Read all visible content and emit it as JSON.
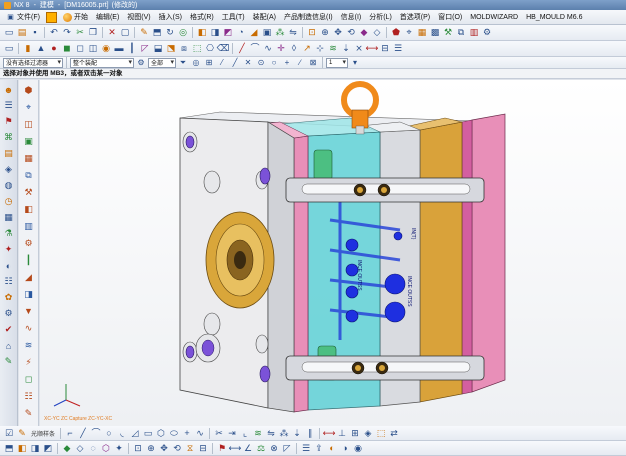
{
  "titlebar": {
    "app_name": "NX 8",
    "application": "建模",
    "file_name": "[DM16005.prt]",
    "status": "(修改的)"
  },
  "menubar": {
    "items": [
      {
        "label": "文件(F)"
      },
      {
        "label": "开始"
      },
      {
        "label": "编辑(E)"
      },
      {
        "label": "视图(V)"
      },
      {
        "label": "插入(S)"
      },
      {
        "label": "格式(R)"
      },
      {
        "label": "工具(T)"
      },
      {
        "label": "装配(A)"
      },
      {
        "label": "产品制造信息(I)"
      },
      {
        "label": "信息(I)"
      },
      {
        "label": "分析(L)"
      },
      {
        "label": "首选项(P)"
      },
      {
        "label": "窗口(O)"
      },
      {
        "label": "MOLDWIZARD"
      },
      {
        "label": "HB_MOULD M6.6"
      }
    ]
  },
  "selection_bar": {
    "filter_value": "没有选择过滤器",
    "assembly_value": "整个装配",
    "scope_value": "全部",
    "layer_value": "1"
  },
  "cue_line": {
    "text": "选择对象并使用 MB3，或者双击某一对象"
  },
  "bottom_toolbar": {
    "label": "光顺样条"
  },
  "graphics": {
    "wcs_label": "XC-YC  ZC  Capture  ZC-YC-XC",
    "plate_text_1": "INCE  OUTSS",
    "plate_text_2": "INCE  OUTSS",
    "plate_text_3": "IN(T)"
  },
  "colors": {
    "plate_pink": "#e88fb8",
    "plate_magenta": "#d35fa0",
    "plate_cyan": "#5fd1d6",
    "plate_gold": "#d9a23a",
    "plate_gray": "#d9dbe0",
    "locating_ring": "#d9a63a",
    "eyebolt": "#f08a1a",
    "cooling_blue": "#1e2fe0",
    "clamp_gray": "#c8ccd4"
  }
}
